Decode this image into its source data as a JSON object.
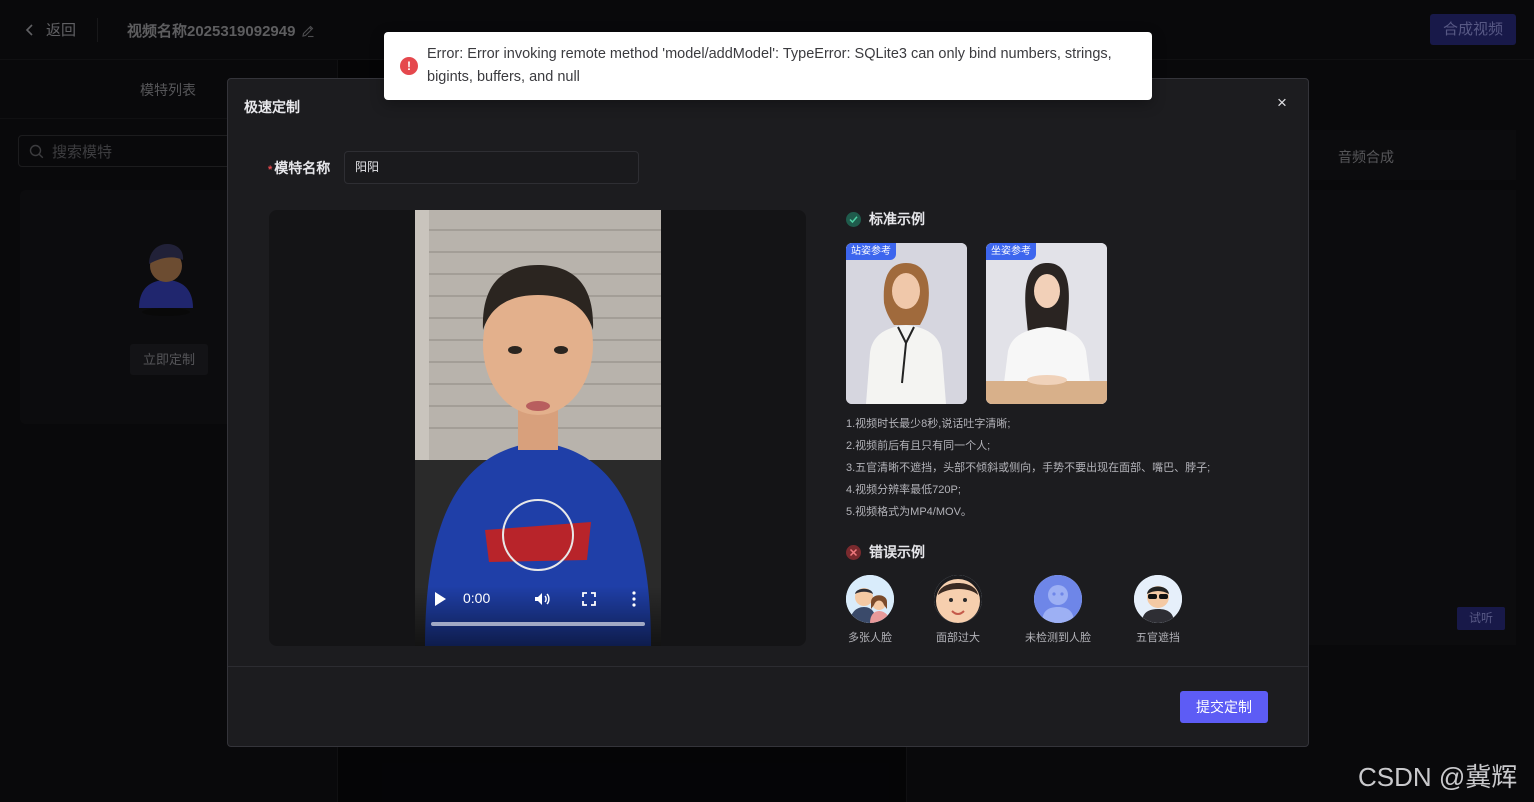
{
  "topbar": {
    "back_label": "返回",
    "video_title": "视频名称2025319092949",
    "synthesize_label": "合成视频"
  },
  "left_panel": {
    "tab_label": "模特列表",
    "search_placeholder": "搜索模特",
    "custom_button": "立即定制"
  },
  "right_panel": {
    "audio_tab": "音频合成",
    "listen_button": "试听"
  },
  "modal": {
    "title": "极速定制",
    "close_glyph": "×",
    "name_label": "模特名称",
    "required_mark": "*",
    "name_value": "阳阳",
    "video": {
      "time": "0:00",
      "progress": 0
    },
    "standard_title": "标准示例",
    "references": [
      {
        "tag": "站姿参考"
      },
      {
        "tag": "坐姿参考"
      }
    ],
    "requirements": [
      "1.视频时长最少8秒,说话吐字清晰;",
      "2.视频前后有且只有同一个人;",
      "3.五官清晰不遮挡，头部不倾斜或侧向，手势不要出现在面部、嘴巴、脖子;",
      "4.视频分辨率最低720P;",
      "5.视频格式为MP4/MOV。"
    ],
    "wrong_title": "错误示例",
    "wrong_examples": [
      {
        "label": "多张人脸"
      },
      {
        "label": "面部过大"
      },
      {
        "label": "未检测到人脸"
      },
      {
        "label": "五官遮挡"
      }
    ],
    "submit_label": "提交定制"
  },
  "toast": {
    "icon": "!",
    "message": "Error: Error invoking remote method 'model/addModel': TypeError: SQLite3 can only bind numbers, strings, bigints, buffers, and null"
  },
  "watermark": "CSDN @冀辉",
  "colors": {
    "accent": "#5d5cf5",
    "error": "#e5484d",
    "success_icon_bg": "#1f5b4c",
    "reference_tag": "#3d66ee"
  }
}
